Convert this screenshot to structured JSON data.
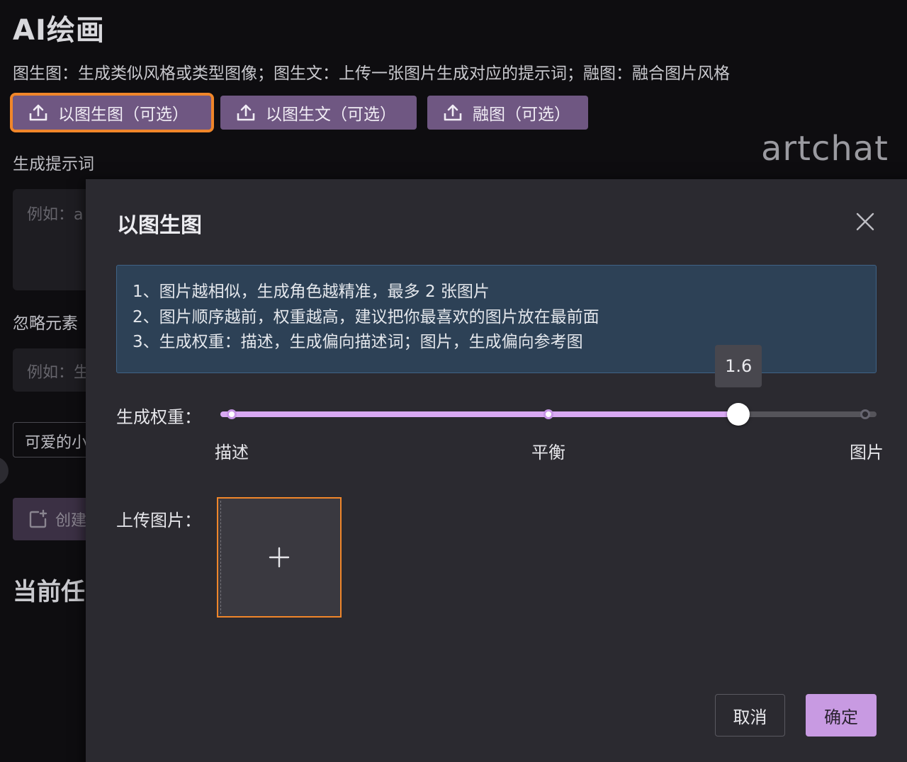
{
  "page": {
    "title": "AI绘画",
    "description": "图生图：生成类似风格或类型图像；图生文：上传一张图片生成对应的提示词；融图：融合图片风格",
    "brand": "artchat"
  },
  "toolbar": {
    "img2img_label": "以图生图（可选）",
    "img2text_label": "以图生文（可选）",
    "blend_label": "融图（可选）"
  },
  "form": {
    "prompt_label": "生成提示词",
    "prompt_placeholder": "例如：a",
    "ignore_label": "忽略元素",
    "ignore_placeholder": "例如：生",
    "tag_text": "可爱的小",
    "create_label": "创建",
    "section_title": "当前任"
  },
  "modal": {
    "title": "以图生图",
    "tips": [
      "1、图片越相似，生成角色越精准，最多 2 张图片",
      "2、图片顺序越前，权重越高，建议把你最喜欢的图片放在最前面",
      "3、生成权重：描述，生成偏向描述词；图片，生成偏向参考图"
    ],
    "weight_label": "生成权重：",
    "weight_value": "1.6",
    "weight_number": 1.6,
    "weight_range": [
      0,
      2
    ],
    "marks": [
      "描述",
      "平衡",
      "图片"
    ],
    "upload_label": "上传图片：",
    "cancel_label": "取消",
    "confirm_label": "确定"
  },
  "colors": {
    "accent": "#c89ae2",
    "highlight": "#f0862a",
    "button_bg": "#6f5782"
  }
}
